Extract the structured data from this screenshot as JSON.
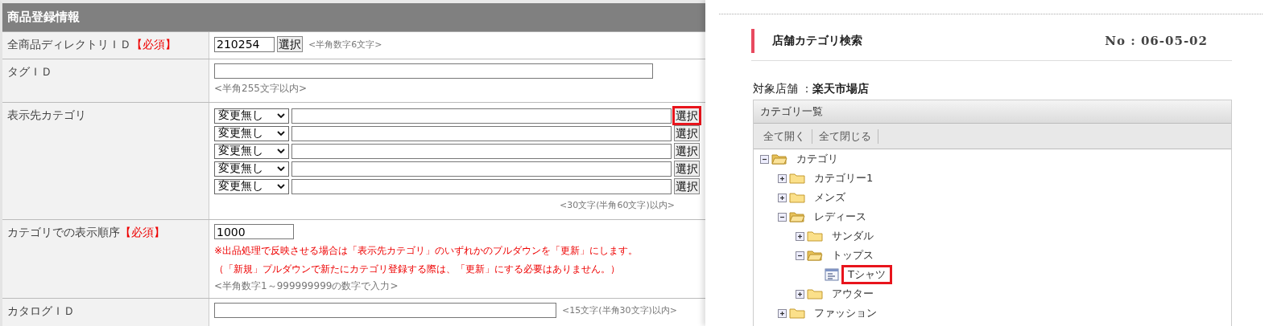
{
  "form": {
    "title": "商品登録情報",
    "rows": [
      {
        "kind": "short",
        "label": "全商品ディレクトリＩＤ",
        "required": "【必須】",
        "value": "210254",
        "button": "選択",
        "hint": "<半角数字6文字>"
      },
      {
        "kind": "wide",
        "label": "タグＩＤ",
        "hint": "<半角255文字以内>"
      },
      {
        "kind": "categories",
        "label": "表示先カテゴリ",
        "entries": [
          {
            "option": "変更無し",
            "button": "選択",
            "highlighted": true
          },
          {
            "option": "変更無し",
            "button": "選択",
            "highlighted": false
          },
          {
            "option": "変更無し",
            "button": "選択",
            "highlighted": false
          },
          {
            "option": "変更無し",
            "button": "選択",
            "highlighted": false
          },
          {
            "option": "変更無し",
            "button": "選択",
            "highlighted": false
          }
        ],
        "hint": "<30文字(半角60文字)以内>"
      },
      {
        "kind": "order",
        "label": "カテゴリでの表示順序",
        "required": "【必須】",
        "value": "1000",
        "notes": [
          "※出品処理で反映させる場合は「表示先カテゴリ」のいずれかのプルダウンを「更新」にします。",
          "（「新規」プルダウンで新たにカテゴリ登録する際は、「更新」にする必要はありません。）"
        ],
        "hint": "<半角数字1～999999999の数字で入力>"
      },
      {
        "kind": "inline",
        "label": "カタログＩＤ",
        "hint": "<15文字(半角30文字)以内>"
      }
    ]
  },
  "panel": {
    "title": "店舗カテゴリ検索",
    "number": "No : 06-05-02",
    "store_label": "対象店舗 ：",
    "store_name": "楽天市場店",
    "list_title": "カテゴリ一覧",
    "toolbar": [
      "全て開く",
      "全て閉じる"
    ],
    "tree": [
      {
        "label": "カテゴリ",
        "kind": "folder",
        "expanded": true,
        "highlighted": false,
        "children": [
          {
            "label": "カテゴリー1",
            "kind": "folder",
            "expanded": false,
            "highlighted": false
          },
          {
            "label": "メンズ",
            "kind": "folder",
            "expanded": false,
            "highlighted": false
          },
          {
            "label": "レディース",
            "kind": "folder",
            "expanded": true,
            "highlighted": false,
            "children": [
              {
                "label": "サンダル",
                "kind": "folder",
                "expanded": false,
                "highlighted": false
              },
              {
                "label": "トップス",
                "kind": "folder",
                "expanded": true,
                "highlighted": false,
                "children": [
                  {
                    "label": "Tシャツ",
                    "kind": "item",
                    "highlighted": true
                  }
                ]
              },
              {
                "label": "アウター",
                "kind": "folder",
                "expanded": false,
                "highlighted": false
              }
            ]
          },
          {
            "label": "ファッション",
            "kind": "folder",
            "expanded": false,
            "highlighted": false
          }
        ]
      }
    ]
  }
}
